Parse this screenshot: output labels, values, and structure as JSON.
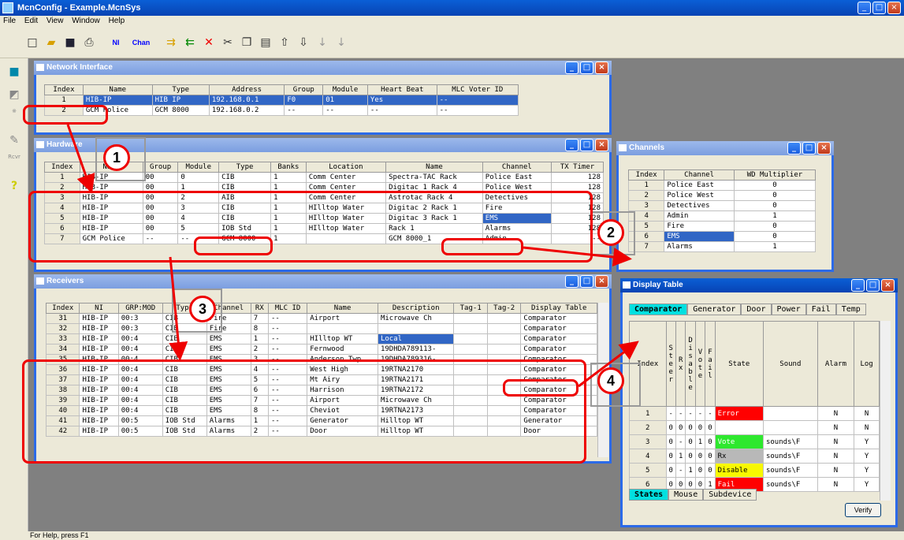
{
  "app": {
    "title": "McnConfig - Example.McnSys"
  },
  "menu": [
    "File",
    "Edit",
    "View",
    "Window",
    "Help"
  ],
  "toolbar": {
    "ni": "NI",
    "chan": "Chan"
  },
  "leftbar": {
    "rcvr": "Rcvr"
  },
  "status": "For Help, press F1",
  "network": {
    "title": "Network Interface",
    "headers": [
      "Index",
      "Name",
      "Type",
      "Address",
      "Group",
      "Module",
      "Heart Beat",
      "MLC Voter ID"
    ],
    "rows": [
      [
        "1",
        "HIB-IP",
        "HIB IP",
        "192.168.0.1",
        "F0",
        "01",
        "Yes",
        "--"
      ],
      [
        "2",
        "GCM Police",
        "GCM 8000",
        "192.168.0.2",
        "--",
        "--",
        "--",
        "--"
      ]
    ]
  },
  "hardware": {
    "title": "Hardware",
    "headers": [
      "Index",
      "Name",
      "Group",
      "Module",
      "Type",
      "Banks",
      "Location",
      "Name",
      "Channel",
      "TX Timer"
    ],
    "rows": [
      [
        "1",
        "HIB-IP",
        "00",
        "0",
        "CIB",
        "1",
        "Comm Center",
        "Spectra-TAC Rack",
        "Police East",
        "128"
      ],
      [
        "2",
        "HIB-IP",
        "00",
        "1",
        "CIB",
        "1",
        "Comm Center",
        "Digitac 1 Rack 4",
        "Police West",
        "128"
      ],
      [
        "3",
        "HIB-IP",
        "00",
        "2",
        "AIB",
        "1",
        "Comm Center",
        "Astrotac Rack 4",
        "Detectives",
        "128"
      ],
      [
        "4",
        "HIB-IP",
        "00",
        "3",
        "CIB",
        "1",
        "HIlltop Water",
        "Digitac 2  Rack 1",
        "Fire",
        "128"
      ],
      [
        "5",
        "HIB-IP",
        "00",
        "4",
        "CIB",
        "1",
        "HIlltop Water",
        "Digitac 3  Rack 1",
        "EMS",
        "128"
      ],
      [
        "6",
        "HIB-IP",
        "00",
        "5",
        "IOB Std",
        "1",
        "HIlltop Water",
        "Rack 1",
        "Alarms",
        "128"
      ],
      [
        "7",
        "GCM Police",
        "--",
        "--",
        "GCM 8000",
        "1",
        "",
        "GCM 8000_1",
        "Admin",
        "--"
      ]
    ]
  },
  "channels": {
    "title": "Channels",
    "headers": [
      "Index",
      "Channel",
      "WD Multiplier"
    ],
    "rows": [
      [
        "1",
        "Police East",
        "0"
      ],
      [
        "2",
        "Police West",
        "0"
      ],
      [
        "3",
        "Detectives",
        "0"
      ],
      [
        "4",
        "Admin",
        "1"
      ],
      [
        "5",
        "Fire",
        "0"
      ],
      [
        "6",
        "EMS",
        "0"
      ],
      [
        "7",
        "Alarms",
        "1"
      ]
    ]
  },
  "receivers": {
    "title": "Receivers",
    "headers": [
      "Index",
      "NI",
      "GRP:MOD",
      "Type",
      "Channel",
      "RX",
      "MLC ID",
      "Name",
      "Description",
      "Tag-1",
      "Tag-2",
      "Display Table"
    ],
    "rows": [
      [
        "31",
        "HIB-IP",
        "00:3",
        "CIB",
        "Fire",
        "7",
        "--",
        "Airport",
        "Microwave Ch",
        "",
        "",
        "Comparator"
      ],
      [
        "32",
        "HIB-IP",
        "00:3",
        "CIB",
        "Fire",
        "8",
        "--",
        "",
        "",
        "",
        "",
        "Comparator"
      ],
      [
        "33",
        "HIB-IP",
        "00:4",
        "CIB",
        "EMS",
        "1",
        "--",
        "HIlltop WT",
        "Local",
        "",
        "",
        "Comparator"
      ],
      [
        "34",
        "HIB-IP",
        "00:4",
        "CIB",
        "EMS",
        "2",
        "--",
        "Fernwood",
        "19DHDA789113-",
        "",
        "",
        "Comparator"
      ],
      [
        "35",
        "HIB-IP",
        "00:4",
        "CIB",
        "EMS",
        "3",
        "--",
        "Anderson Twp",
        "19DHDA789316-",
        "",
        "",
        "Comparator"
      ],
      [
        "36",
        "HIB-IP",
        "00:4",
        "CIB",
        "EMS",
        "4",
        "--",
        "West High",
        "19RTNA2170",
        "",
        "",
        "Comparator"
      ],
      [
        "37",
        "HIB-IP",
        "00:4",
        "CIB",
        "EMS",
        "5",
        "--",
        "Mt Airy",
        "19RTNA2171",
        "",
        "",
        "Comparator"
      ],
      [
        "38",
        "HIB-IP",
        "00:4",
        "CIB",
        "EMS",
        "6",
        "--",
        "Harrison",
        "19RTNA2172",
        "",
        "",
        "Comparator"
      ],
      [
        "39",
        "HIB-IP",
        "00:4",
        "CIB",
        "EMS",
        "7",
        "--",
        "Airport",
        "Microwave Ch",
        "",
        "",
        "Comparator"
      ],
      [
        "40",
        "HIB-IP",
        "00:4",
        "CIB",
        "EMS",
        "8",
        "--",
        "Cheviot",
        "19RTNA2173",
        "",
        "",
        "Comparator"
      ],
      [
        "41",
        "HIB-IP",
        "00:5",
        "IOB Std",
        "Alarms",
        "1",
        "--",
        "Generator",
        "Hilltop WT",
        "",
        "",
        "Generator"
      ],
      [
        "42",
        "HIB-IP",
        "00:5",
        "IOB Std",
        "Alarms",
        "2",
        "--",
        "Door",
        "Hilltop WT",
        "",
        "",
        "Door"
      ]
    ]
  },
  "display": {
    "title": "Display Table",
    "tabs": [
      "Comparator",
      "Generator",
      "Door",
      "Power",
      "Fail",
      "Temp"
    ],
    "headers": [
      "Index",
      "Steer",
      "Rx",
      "Disable",
      "Vote",
      "Fail",
      "State",
      "Sound",
      "Alarm",
      "Log"
    ],
    "rows": [
      [
        "1",
        "-",
        "-",
        "-",
        "-",
        "-",
        "Error",
        "",
        "N",
        "N"
      ],
      [
        "2",
        "0",
        "0",
        "0",
        "0",
        "0",
        "",
        "",
        "N",
        "N"
      ],
      [
        "3",
        "0",
        "-",
        "0",
        "1",
        "0",
        "Vote",
        "sounds\\F",
        "N",
        "Y"
      ],
      [
        "4",
        "0",
        "1",
        "0",
        "0",
        "0",
        "Rx",
        "sounds\\F",
        "N",
        "Y"
      ],
      [
        "5",
        "0",
        "-",
        "1",
        "0",
        "0",
        "Disable",
        "sounds\\F",
        "N",
        "Y"
      ],
      [
        "6",
        "0",
        "0",
        "0",
        "0",
        "1",
        "Fail",
        "sounds\\F",
        "N",
        "Y"
      ]
    ],
    "bottom_tabs": [
      "States",
      "Mouse",
      "Subdevice"
    ],
    "verify": "Verify"
  },
  "callouts": [
    "1",
    "2",
    "3",
    "4"
  ]
}
